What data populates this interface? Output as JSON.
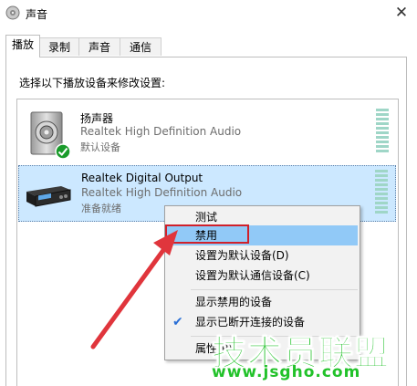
{
  "window": {
    "title": "声音",
    "close_glyph": "✕"
  },
  "tabs": [
    {
      "label": "播放"
    },
    {
      "label": "录制"
    },
    {
      "label": "声音"
    },
    {
      "label": "通信"
    }
  ],
  "instruction": "选择以下播放设备来修改设置:",
  "devices": [
    {
      "name": "扬声器",
      "description": "Realtek High Definition Audio",
      "status": "默认设备",
      "icon": "speaker-icon"
    },
    {
      "name": "Realtek Digital Output",
      "description": "Realtek High Definition Audio",
      "status": "准备就绪",
      "icon": "digital-output-icon"
    }
  ],
  "context_menu": {
    "items": [
      {
        "label": "测试"
      },
      {
        "label": "禁用"
      },
      {
        "label": "设置为默认设备(D)"
      },
      {
        "label": "设置为默认通信设备(C)"
      },
      {
        "label": "显示禁用的设备"
      },
      {
        "label": "显示已断开连接的设备",
        "checked": true
      },
      {
        "label": "属性(P)"
      }
    ]
  },
  "watermark": {
    "text": "技术员联盟",
    "url": "www.jsgho.com"
  },
  "colors": {
    "selection": "#cce8ff",
    "menu_hover": "#91c9f7",
    "annotation_red": "#d0202a",
    "watermark_green": "#22c22a"
  }
}
